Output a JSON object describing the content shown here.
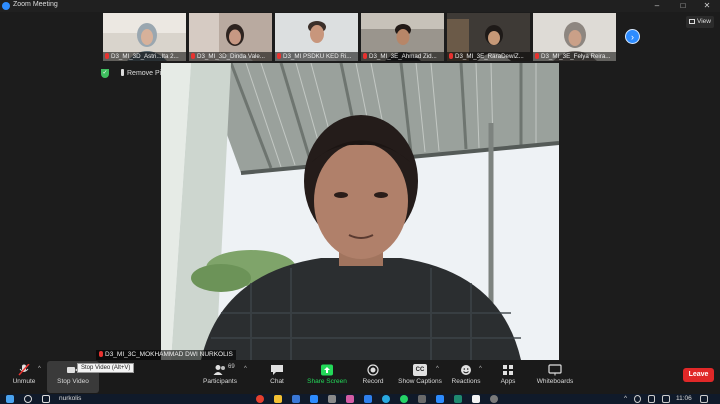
{
  "window": {
    "title": "Zoom Meeting"
  },
  "filmstrip": {
    "tiles": [
      {
        "name": "D3_MI_3D_Astri...Ita 2..."
      },
      {
        "name": "D3_MI_3D_Dinda Vale..."
      },
      {
        "name": "D3_MI PSDKU KED Ri..."
      },
      {
        "name": "D3_MI_3E_Ahmad Zid..."
      },
      {
        "name": "D3_MI_3E_RaraDewiZ..."
      },
      {
        "name": "D3_MI_3E_Felya Reira..."
      }
    ],
    "view_label": "View"
  },
  "pin": {
    "remove_label": "Remove Pin"
  },
  "main": {
    "speaker_name": "D3_MI_3C_MOKHAMMAD DWI NURKOLIS"
  },
  "controls": {
    "unmute": "Unmute",
    "stop_video": "Stop Video",
    "tooltip": "Stop Video (Alt+V)",
    "participants": "Participants",
    "participant_count": "69",
    "chat": "Chat",
    "share_screen": "Share Screen",
    "record": "Record",
    "captions": "Show Captions",
    "captions_icon_text": "CC",
    "reactions": "Reactions",
    "apps": "Apps",
    "whiteboards": "Whiteboards",
    "leave": "Leave"
  },
  "taskbar": {
    "search_text": "nurkolis",
    "clock": "11:06"
  },
  "colors": {
    "accent_blue": "#2d8cff",
    "leave_red": "#e02828",
    "share_green": "#23d959",
    "muted_red": "#e8322f"
  }
}
